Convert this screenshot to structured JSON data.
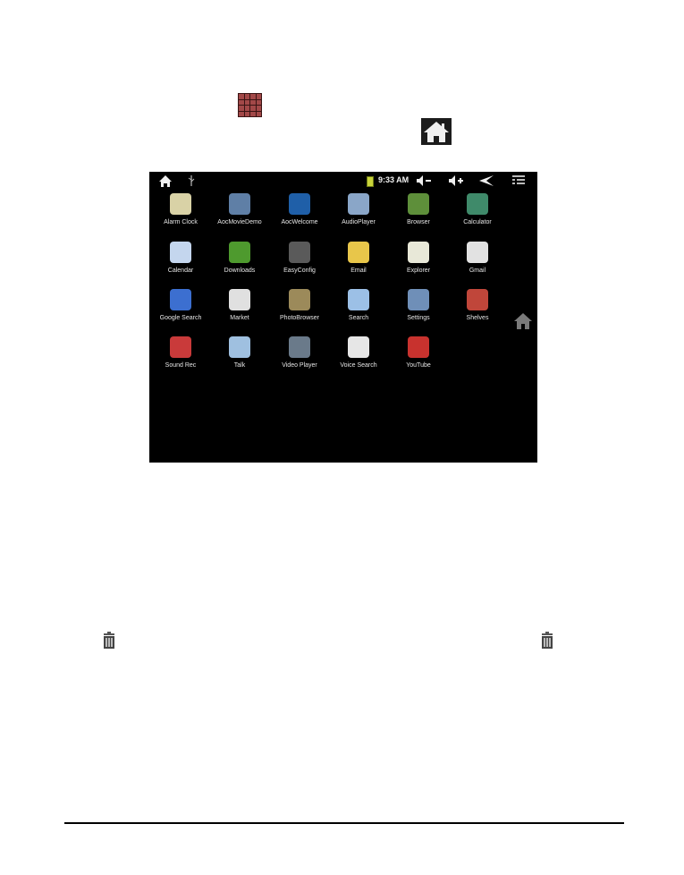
{
  "status_bar": {
    "time": "9:33 AM",
    "icons": [
      "home-icon",
      "usb-icon",
      "battery-icon",
      "volume-down-icon",
      "volume-up-icon",
      "back-icon",
      "menu-icon"
    ]
  },
  "apps": [
    {
      "label": "Alarm Clock",
      "icon": "alarm-clock-icon",
      "color": "#d9d2a6"
    },
    {
      "label": "AocMovieDemo",
      "icon": "movie-icon",
      "color": "#5f7fa6"
    },
    {
      "label": "AocWelcome",
      "icon": "aoc-logo-icon",
      "color": "#1f5fa8"
    },
    {
      "label": "AudioPlayer",
      "icon": "audio-icon",
      "color": "#8aa6c8"
    },
    {
      "label": "Browser",
      "icon": "globe-icon",
      "color": "#5e8f3a"
    },
    {
      "label": "Calculator",
      "icon": "calculator-icon",
      "color": "#3f8a6a"
    },
    {
      "label": "Calendar",
      "icon": "calendar-icon",
      "color": "#c4d6ee"
    },
    {
      "label": "Downloads",
      "icon": "download-icon",
      "color": "#4e9a2e"
    },
    {
      "label": "EasyConfig",
      "icon": "config-icon",
      "color": "#5a5a5a"
    },
    {
      "label": "Email",
      "icon": "envelope-icon",
      "color": "#e8c64a"
    },
    {
      "label": "Explorer",
      "icon": "folder-icon",
      "color": "#e8e8d8"
    },
    {
      "label": "Gmail",
      "icon": "gmail-icon",
      "color": "#e2e2e2"
    },
    {
      "label": "Google Search",
      "icon": "google-icon",
      "color": "#3c6fd0"
    },
    {
      "label": "Market",
      "icon": "market-bag-icon",
      "color": "#e0e0e0"
    },
    {
      "label": "PhotoBrowser",
      "icon": "camera-icon",
      "color": "#9c8a5a"
    },
    {
      "label": "Search",
      "icon": "magnifier-icon",
      "color": "#9cc0e6"
    },
    {
      "label": "Settings",
      "icon": "gears-icon",
      "color": "#6f8fb8"
    },
    {
      "label": "Shelves",
      "icon": "books-icon",
      "color": "#c0463a"
    },
    {
      "label": "Sound Rec",
      "icon": "microphone-red-icon",
      "color": "#c93a3a"
    },
    {
      "label": "Talk",
      "icon": "talk-bubble-icon",
      "color": "#9fc0e0"
    },
    {
      "label": "Video Player",
      "icon": "video-reel-icon",
      "color": "#6a7a8a"
    },
    {
      "label": "Voice Search",
      "icon": "microphone-icon",
      "color": "#e6e6e6"
    },
    {
      "label": "YouTube",
      "icon": "youtube-icon",
      "color": "#c8322e"
    }
  ]
}
